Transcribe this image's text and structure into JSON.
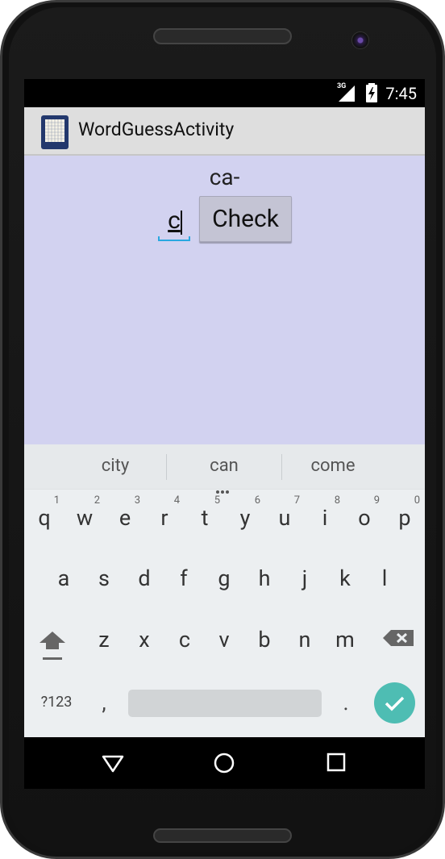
{
  "status_bar": {
    "network_label": "3G",
    "time": "7:45"
  },
  "action_bar": {
    "title": "WordGuessActivity"
  },
  "content": {
    "hint": "ca-",
    "guess_value": "c",
    "check_button": "Check",
    "background_color": "#d2d2f0"
  },
  "keyboard": {
    "suggestions": [
      "city",
      "can",
      "come"
    ],
    "row1": [
      {
        "key": "q",
        "num": "1"
      },
      {
        "key": "w",
        "num": "2"
      },
      {
        "key": "e",
        "num": "3"
      },
      {
        "key": "r",
        "num": "4"
      },
      {
        "key": "t",
        "num": "5"
      },
      {
        "key": "y",
        "num": "6"
      },
      {
        "key": "u",
        "num": "7"
      },
      {
        "key": "i",
        "num": "8"
      },
      {
        "key": "o",
        "num": "9"
      },
      {
        "key": "p",
        "num": "0"
      }
    ],
    "row2": [
      "a",
      "s",
      "d",
      "f",
      "g",
      "h",
      "j",
      "k",
      "l"
    ],
    "row3": [
      "z",
      "x",
      "c",
      "v",
      "b",
      "n",
      "m"
    ],
    "symbols_label": "?123",
    "comma": ",",
    "period": ".",
    "enter_color": "#4ebdb3"
  },
  "icons": {
    "shift": "shift-icon",
    "backspace": "backspace-icon",
    "enter": "checkmark-icon",
    "back": "back-triangle-icon",
    "home": "home-circle-icon",
    "recents": "recents-square-icon"
  }
}
